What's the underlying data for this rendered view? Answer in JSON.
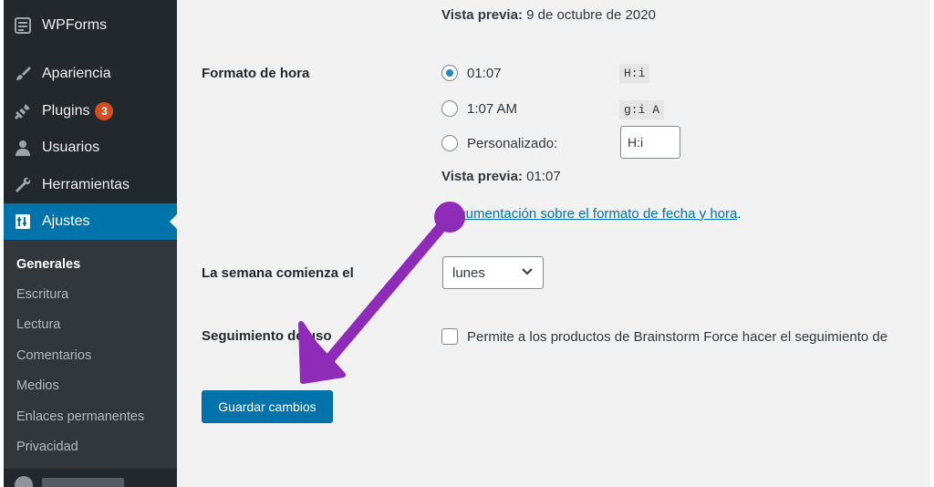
{
  "sidebar": {
    "menu": [
      {
        "label": "WPForms",
        "icon": "wpforms-icon"
      },
      {
        "label": "Apariencia",
        "icon": "paintbrush-icon"
      },
      {
        "label": "Plugins",
        "icon": "plugin-icon",
        "badge": "3"
      },
      {
        "label": "Usuarios",
        "icon": "user-icon"
      },
      {
        "label": "Herramientas",
        "icon": "wrench-icon"
      },
      {
        "label": "Ajustes",
        "icon": "settings-icon",
        "active": true
      }
    ],
    "submenu": [
      "Generales",
      "Escritura",
      "Lectura",
      "Comentarios",
      "Medios",
      "Enlaces permanentes",
      "Privacidad"
    ],
    "submenu_current": "Generales"
  },
  "settings": {
    "date_preview_label": "Vista previa:",
    "date_preview_value": "9 de octubre de 2020",
    "time_format": {
      "label": "Formato de hora",
      "options": [
        {
          "label": "01:07",
          "code": "H:i",
          "checked": true
        },
        {
          "label": "1:07 AM",
          "code": "g:i A",
          "checked": false
        },
        {
          "label": "Personalizado:",
          "input_value": "H:i",
          "checked": false
        }
      ],
      "preview_label": "Vista previa:",
      "preview_value": "01:07"
    },
    "doc_link": "Documentación sobre el formato de fecha y hora",
    "doc_link_suffix": ".",
    "week_start": {
      "label": "La semana comienza el",
      "value": "lunes"
    },
    "usage_tracking": {
      "label": "Seguimiento de uso",
      "text": "Permite a los productos de Brainstorm Force hacer el seguimiento de"
    },
    "save_button": "Guardar cambios"
  },
  "annotation": {
    "color": "#8e2bb8",
    "icon": "annotation-arrow-icon"
  },
  "colors": {
    "sidebar_bg": "#23282d",
    "submenu_bg": "#32373c",
    "accent": "#0073aa",
    "badge": "#d54e21"
  }
}
